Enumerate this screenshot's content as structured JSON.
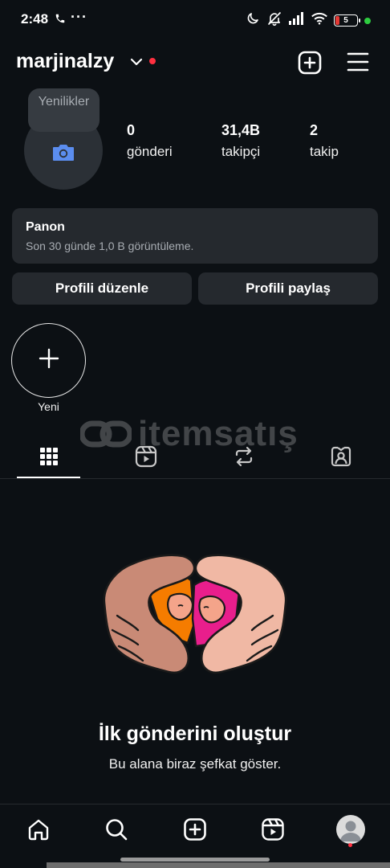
{
  "status_bar": {
    "time": "2:48",
    "more": "···",
    "battery_level": "5"
  },
  "header": {
    "username": "marjinalzy"
  },
  "profile": {
    "tooltip": "Yenilikler",
    "stats": [
      {
        "value": "0",
        "label": "gönderi"
      },
      {
        "value": "31,4B",
        "label": "takipçi"
      },
      {
        "value": "2",
        "label": "takip"
      }
    ]
  },
  "dashboard": {
    "title": "Panon",
    "subtitle": "Son 30 günde 1,0 B görüntüleme."
  },
  "buttons": {
    "edit_profile": "Profili düzenle",
    "share_profile": "Profili paylaş"
  },
  "highlights": {
    "new_label": "Yeni"
  },
  "watermark": {
    "text": "itemsatış"
  },
  "tabs": [
    {
      "icon": "grid-icon",
      "active": true
    },
    {
      "icon": "reels-icon",
      "active": false
    },
    {
      "icon": "repost-icon",
      "active": false
    },
    {
      "icon": "tagged-icon",
      "active": false
    }
  ],
  "empty_state": {
    "title": "İlk gönderini oluştur",
    "subtitle": "Bu alana biraz şefkat göster."
  },
  "bottom_nav": [
    {
      "icon": "home-icon"
    },
    {
      "icon": "search-icon"
    },
    {
      "icon": "create-icon"
    },
    {
      "icon": "reels-icon"
    },
    {
      "icon": "profile-avatar"
    }
  ],
  "colors": {
    "background": "#0c1014",
    "card": "#25292e",
    "accent_blue": "#5b8def",
    "notification_red": "#ff3040"
  }
}
